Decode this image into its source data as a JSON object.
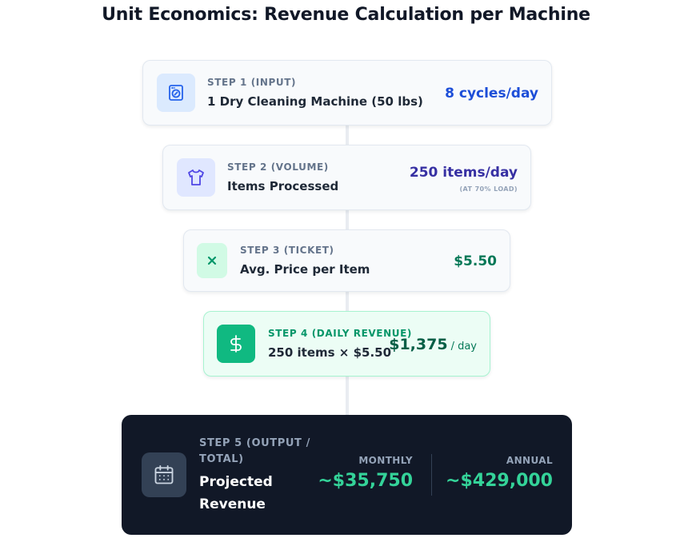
{
  "title": "Unit Economics: Revenue Calculation per Machine",
  "steps": [
    {
      "label": "STEP 1 (INPUT)",
      "description": "1 Dry Cleaning Machine (50 lbs)",
      "value": "8 cycles/day",
      "icon": "washing-machine-icon",
      "accent": "#1d4ed8"
    },
    {
      "label": "STEP 2 (VOLUME)",
      "description": "Items Processed",
      "value": "250 items/day",
      "note": "(AT 70% LOAD)",
      "icon": "shirt-icon",
      "accent": "#3730a3"
    },
    {
      "label": "STEP 3 (TICKET)",
      "description": "Avg. Price per Item",
      "value": "$5.50",
      "icon": "multiply-icon",
      "accent": "#047857"
    },
    {
      "label": "STEP 4 (DAILY REVENUE)",
      "description": "250 items × $5.50",
      "value": "$1,375",
      "unit": "/ day",
      "icon": "dollar-icon",
      "accent": "#10b981"
    }
  ],
  "output": {
    "label": "STEP 5 (OUTPUT / TOTAL)",
    "description": "Projected Revenue",
    "icon": "calendar-icon",
    "monthly_label": "MONTHLY",
    "monthly_value": "~$35,750",
    "annual_label": "ANNUAL",
    "annual_value": "~$429,000",
    "accent": "#34d399"
  }
}
